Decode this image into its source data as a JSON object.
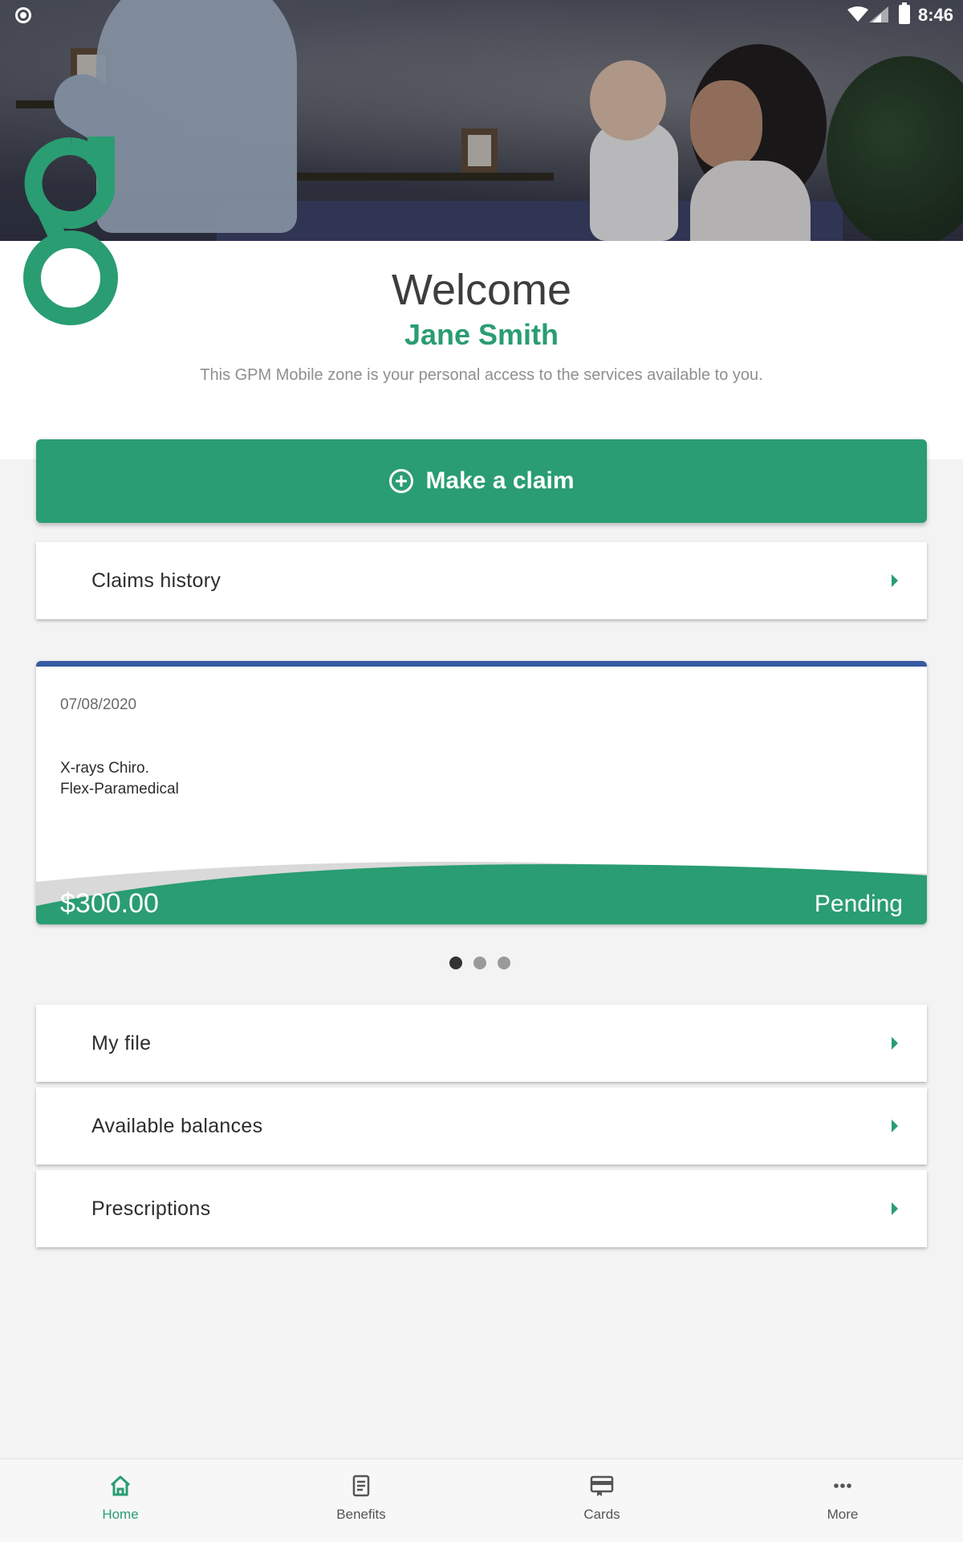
{
  "status_bar": {
    "time": "8:46"
  },
  "welcome": {
    "title": "Welcome",
    "name": "Jane Smith",
    "description": "This GPM Mobile zone is your personal access to the services available to you."
  },
  "actions": {
    "make_claim_label": "Make a claim",
    "claims_history_label": "Claims history"
  },
  "claim_card": {
    "date": "07/08/2020",
    "description_line1": "X-rays Chiro.",
    "description_line2": "Flex-Paramedical",
    "amount": "$300.00",
    "status": "Pending",
    "accent_color": "#355ba0"
  },
  "pager": {
    "count": 3,
    "active_index": 0
  },
  "menu": {
    "my_file": "My file",
    "available_balances": "Available balances",
    "prescriptions": "Prescriptions"
  },
  "bottom_nav": [
    {
      "label": "Home",
      "icon": "home-icon",
      "active": true
    },
    {
      "label": "Benefits",
      "icon": "document-icon",
      "active": false
    },
    {
      "label": "Cards",
      "icon": "card-icon",
      "active": false
    },
    {
      "label": "More",
      "icon": "more-icon",
      "active": false
    }
  ],
  "colors": {
    "brand_green": "#2a9d72",
    "card_top_accent": "#355ba0"
  }
}
